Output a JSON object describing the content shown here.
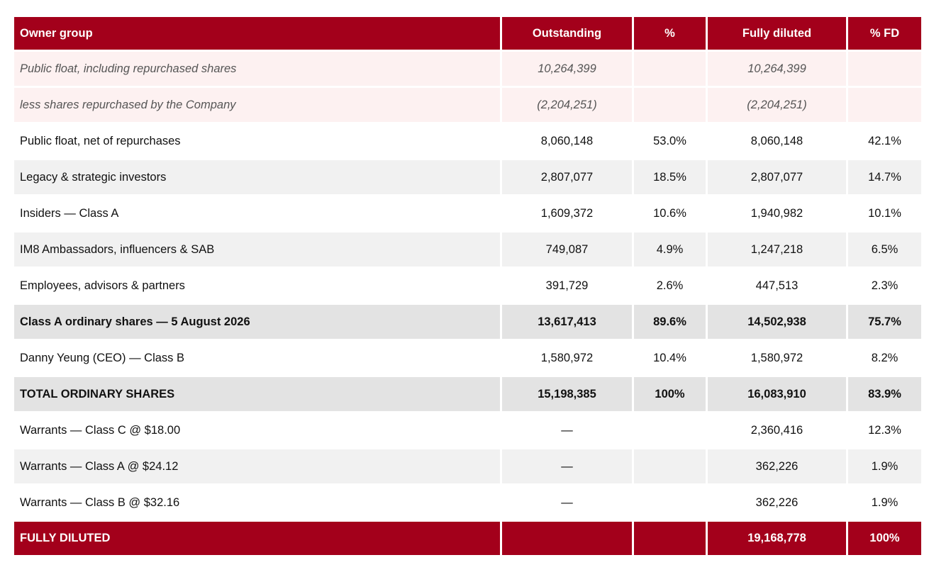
{
  "header": {
    "owner_group": "Owner group",
    "outstanding": "Outstanding",
    "pct": "%",
    "fully_diluted": "Fully diluted",
    "pct_fd": "% FD"
  },
  "rows": [
    {
      "group": "Public float, including repurchased shares",
      "outstanding": "10,264,399",
      "pct": "",
      "fully_diluted": "10,264,399",
      "pct_fd": ""
    },
    {
      "group": "less shares repurchased by the Company",
      "outstanding": "(2,204,251)",
      "pct": "",
      "fully_diluted": "(2,204,251)",
      "pct_fd": ""
    },
    {
      "group": "Public float, net of repurchases",
      "outstanding": "8,060,148",
      "pct": "53.0%",
      "fully_diluted": "8,060,148",
      "pct_fd": "42.1%"
    },
    {
      "group": "Legacy & strategic investors",
      "outstanding": "2,807,077",
      "pct": "18.5%",
      "fully_diluted": "2,807,077",
      "pct_fd": "14.7%"
    },
    {
      "group": "Insiders — Class A",
      "outstanding": "1,609,372",
      "pct": "10.6%",
      "fully_diluted": "1,940,982",
      "pct_fd": "10.1%"
    },
    {
      "group": "IM8 Ambassadors, influencers & SAB",
      "outstanding": "749,087",
      "pct": "4.9%",
      "fully_diluted": "1,247,218",
      "pct_fd": "6.5%"
    },
    {
      "group": "Employees, advisors & partners",
      "outstanding": "391,729",
      "pct": "2.6%",
      "fully_diluted": "447,513",
      "pct_fd": "2.3%"
    },
    {
      "group": "Class A ordinary shares — 5 August 2026",
      "outstanding": "13,617,413",
      "pct": "89.6%",
      "fully_diluted": "14,502,938",
      "pct_fd": "75.7%"
    },
    {
      "group": "Danny Yeung (CEO) — Class B",
      "outstanding": "1,580,972",
      "pct": "10.4%",
      "fully_diluted": "1,580,972",
      "pct_fd": "8.2%"
    },
    {
      "group": "TOTAL ORDINARY SHARES",
      "outstanding": "15,198,385",
      "pct": "100%",
      "fully_diluted": "16,083,910",
      "pct_fd": "83.9%"
    },
    {
      "group": "Warrants — Class C @ $18.00",
      "outstanding": "—",
      "pct": "",
      "fully_diluted": "2,360,416",
      "pct_fd": "12.3%"
    },
    {
      "group": "Warrants — Class A @ $24.12",
      "outstanding": "—",
      "pct": "",
      "fully_diluted": "362,226",
      "pct_fd": "1.9%"
    },
    {
      "group": "Warrants — Class B @ $32.16",
      "outstanding": "—",
      "pct": "",
      "fully_diluted": "362,226",
      "pct_fd": "1.9%"
    },
    {
      "group": "FULLY DILUTED",
      "outstanding": "",
      "pct": "",
      "fully_diluted": "19,168,778",
      "pct_fd": "100%"
    }
  ],
  "colors": {
    "header_red": "#a3001b",
    "italic_row_bg": "#fdf1f1",
    "stripe_grey": "#f1f1f1",
    "subtotal_grey": "#e3e3e3"
  }
}
